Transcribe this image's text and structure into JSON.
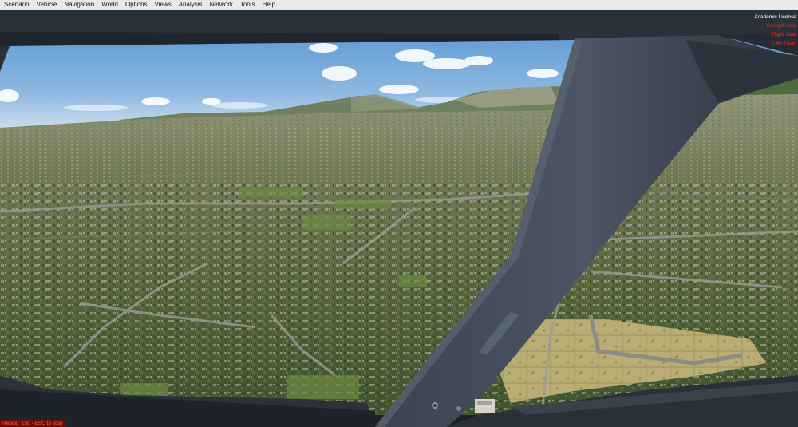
{
  "menu": {
    "items": [
      {
        "label": "Scenario"
      },
      {
        "label": "Vehicle"
      },
      {
        "label": "Navigation"
      },
      {
        "label": "World"
      },
      {
        "label": "Options"
      },
      {
        "label": "Views"
      },
      {
        "label": "Analysis"
      },
      {
        "label": "Network"
      },
      {
        "label": "Tools"
      },
      {
        "label": "Help"
      }
    ]
  },
  "hud": {
    "license": "Academic License",
    "view_mode": "Cockpit View",
    "seat": "Right Seat",
    "zoom": "0.40 Zoom",
    "replay": "Replay: 150 - ESC to stop"
  },
  "colors": {
    "hud_text_red": "#ff2a1a",
    "hud_text_white": "#ffffff",
    "replay_text": "#ff5a4a"
  }
}
